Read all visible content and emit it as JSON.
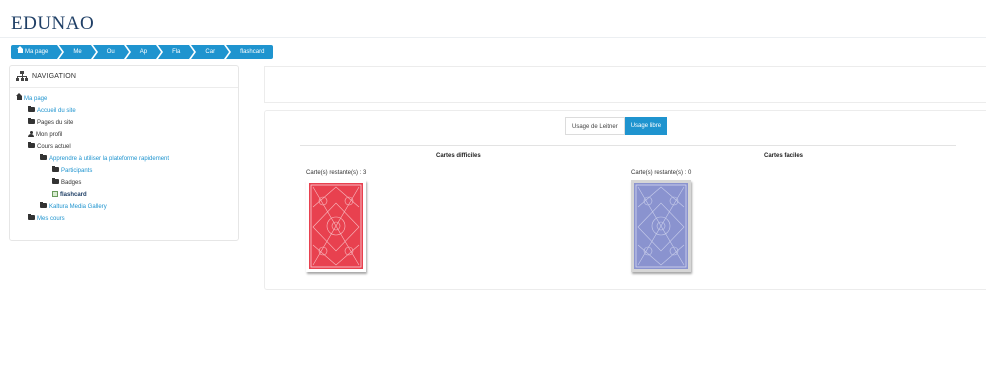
{
  "brand": {
    "logo_text": "EDUNAO",
    "tagline": ""
  },
  "breadcrumb": [
    {
      "label": "Ma page"
    },
    {
      "label": "Me"
    },
    {
      "label": "Ou"
    },
    {
      "label": "Ap"
    },
    {
      "label": "Fla"
    },
    {
      "label": "Car"
    },
    {
      "label": "flashcard"
    }
  ],
  "navigation": {
    "title": "NAVIGATION",
    "items": [
      {
        "label": "Ma page",
        "icon": "home-icon",
        "link": true
      },
      {
        "label": "Accueil du site",
        "icon": "folder-icon",
        "link": true
      },
      {
        "label": "Pages du site",
        "icon": "folder-icon",
        "link": false
      },
      {
        "label": "Mon profil",
        "icon": "user-icon",
        "link": false
      },
      {
        "label": "Cours actuel",
        "icon": "folder-icon",
        "link": false
      },
      {
        "label": "Apprendre à utiliser la plateforme rapidement",
        "icon": "folder-icon",
        "link": true
      },
      {
        "label": "Participants",
        "icon": "folder-icon",
        "link": true
      },
      {
        "label": "Badges",
        "icon": "folder-icon",
        "link": false
      },
      {
        "label": "flashcard",
        "icon": "flashcard-icon",
        "link": false,
        "active": true
      },
      {
        "label": "Kaltura Media Gallery",
        "icon": "folder-icon",
        "link": true
      },
      {
        "label": "Mes cours",
        "icon": "folder-icon",
        "link": true
      }
    ]
  },
  "tabs": [
    {
      "label": "Usage de Leitner",
      "active": false
    },
    {
      "label": "Usage libre",
      "active": true
    }
  ],
  "decks": {
    "difficult": {
      "title": "Cartes difficiles",
      "remaining": "Carte(s) restante(s) : 3",
      "card_color": "#e8414f"
    },
    "easy": {
      "title": "Cartes faciles",
      "remaining": "Carte(s) restante(s) : 0",
      "card_color": "#8a93cf"
    }
  },
  "colors": {
    "accent": "#1f94cf",
    "brand": "#1f3f66"
  }
}
